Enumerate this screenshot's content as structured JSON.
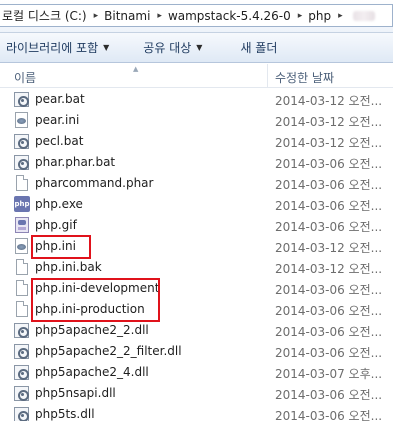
{
  "address_bar": {
    "crumbs": [
      "로컬 디스크 (C:)",
      "Bitnami",
      "wampstack-5.4.26-0",
      "php"
    ],
    "separator": "▸"
  },
  "toolbar": {
    "library_label": "라이브러리에 포함",
    "share_label": "공유 대상",
    "new_folder_label": "새 폴더"
  },
  "columns": {
    "name": "이름",
    "date_modified": "수정한 날짜"
  },
  "files": [
    {
      "name": "pear.bat",
      "date": "2014-03-12 오전...",
      "icon": "batch-gear-icon"
    },
    {
      "name": "pear.ini",
      "date": "2014-03-12 오전...",
      "icon": "ini-settings-icon"
    },
    {
      "name": "pecl.bat",
      "date": "2014-03-12 오전...",
      "icon": "batch-gear-icon"
    },
    {
      "name": "phar.phar.bat",
      "date": "2014-03-06 오전...",
      "icon": "batch-gear-icon"
    },
    {
      "name": "pharcommand.phar",
      "date": "2014-03-06 오전...",
      "icon": "blank-file-icon"
    },
    {
      "name": "php.exe",
      "date": "2014-03-06 오전...",
      "icon": "php-exe-icon"
    },
    {
      "name": "php.gif",
      "date": "2014-03-06 오전...",
      "icon": "gif-image-icon"
    },
    {
      "name": "php.ini",
      "date": "2014-03-12 오전...",
      "icon": "ini-settings-icon"
    },
    {
      "name": "php.ini.bak",
      "date": "2014-03-12 오전...",
      "icon": "blank-file-icon"
    },
    {
      "name": "php.ini-development",
      "date": "2014-03-06 오전...",
      "icon": "blank-file-icon"
    },
    {
      "name": "php.ini-production",
      "date": "2014-03-06 오전...",
      "icon": "blank-file-icon"
    },
    {
      "name": "php5apache2_2.dll",
      "date": "2014-03-06 오전...",
      "icon": "dll-gear-icon"
    },
    {
      "name": "php5apache2_2_filter.dll",
      "date": "2014-03-06 오전...",
      "icon": "dll-gear-icon"
    },
    {
      "name": "php5apache2_4.dll",
      "date": "2014-03-07 오후...",
      "icon": "dll-gear-icon"
    },
    {
      "name": "php5nsapi.dll",
      "date": "2014-03-06 오전...",
      "icon": "dll-gear-icon"
    },
    {
      "name": "php5ts.dll",
      "date": "2014-03-06 오전...",
      "icon": "dll-gear-icon"
    }
  ],
  "colors": {
    "highlight_border": "#e0121b",
    "date_text": "#6d6d6d",
    "header_text": "#4c607a"
  }
}
